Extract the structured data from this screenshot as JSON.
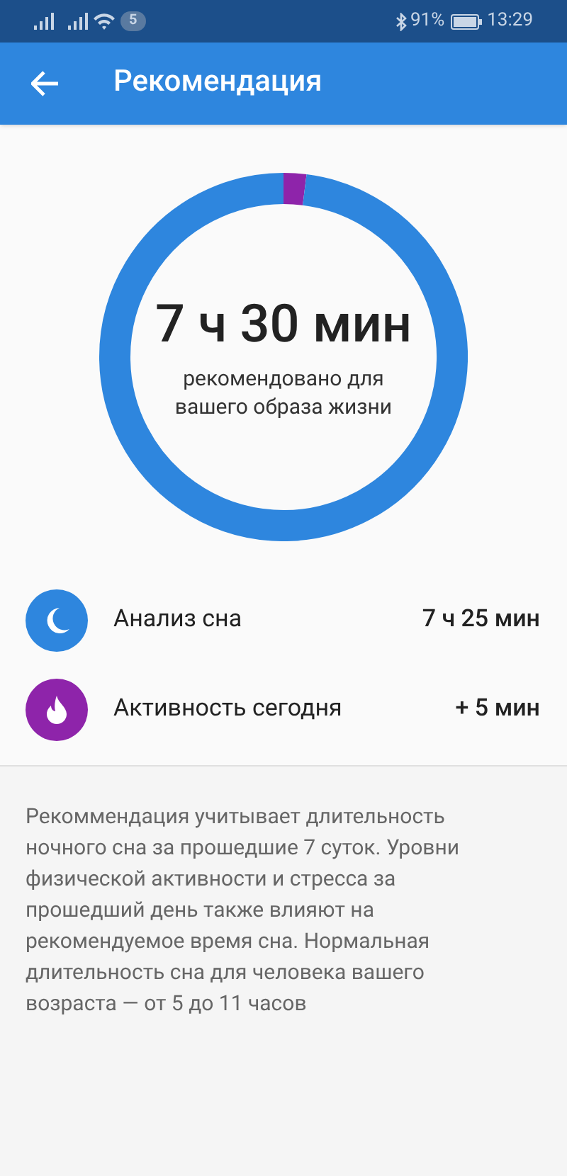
{
  "status_bar": {
    "notification_count": "5",
    "battery": "91%",
    "time": "13:29"
  },
  "header": {
    "title": "Рекомендация"
  },
  "ring": {
    "value": "7 ч 30 мин",
    "caption": "рекомендовано для вашего образа жизни",
    "segments": [
      {
        "color": "#8e24aa"
      },
      {
        "color": "#2e86de"
      }
    ]
  },
  "items": [
    {
      "kind": "sleep",
      "label": "Анализ сна",
      "value": "7 ч 25 мин",
      "color": "#2e86de"
    },
    {
      "kind": "activity",
      "label": "Активность сегодня",
      "value": "+ 5 мин",
      "color": "#8e24aa"
    }
  ],
  "note": "Рекоммендация учитывает длительность ночного сна за прошедшие 7 суток. Уровни физической активности и стресса за прошедший день также влияют на рекомендуемое время сна. Нормальная длительность сна для человека вашего возраста — от 5 до 11 часов"
}
